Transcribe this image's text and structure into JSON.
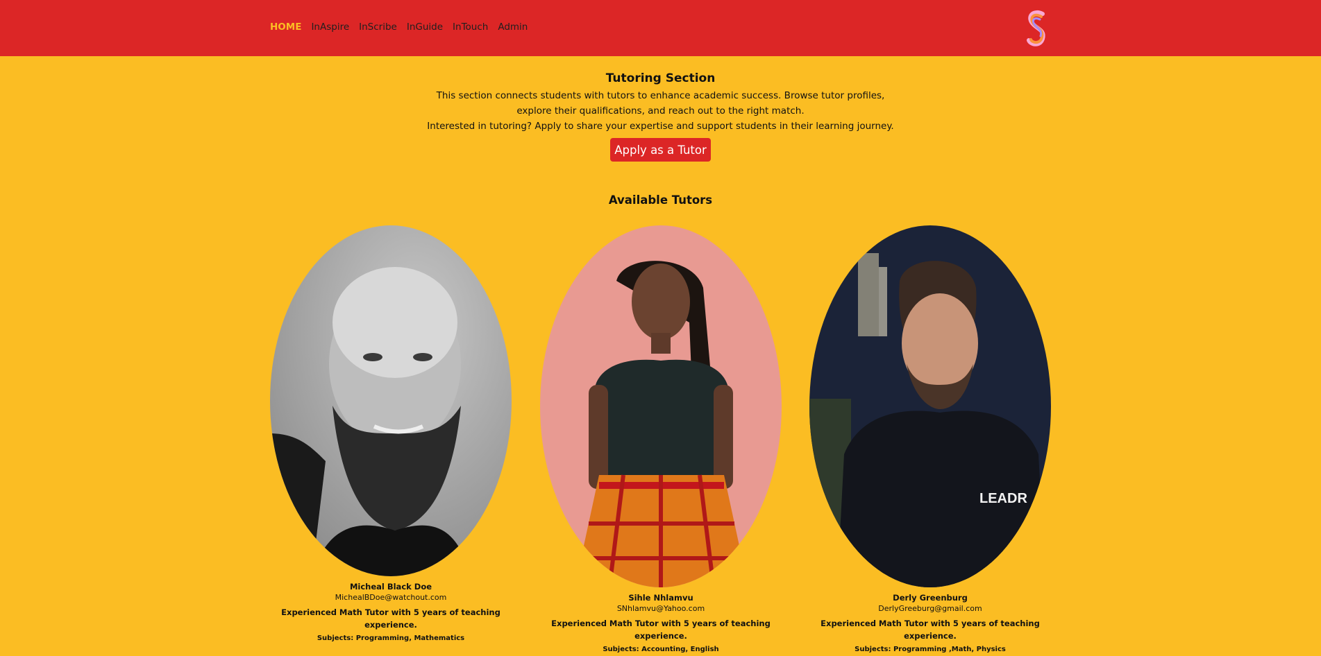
{
  "nav": {
    "items": [
      {
        "label": "HOME",
        "active": true
      },
      {
        "label": "InAspire",
        "active": false
      },
      {
        "label": "InScribe",
        "active": false
      },
      {
        "label": "InGuide",
        "active": false
      },
      {
        "label": "InTouch",
        "active": false
      },
      {
        "label": "Admin",
        "active": false
      }
    ],
    "logo_icon": "brand-s-logo-icon"
  },
  "intro": {
    "title": "Tutoring Section",
    "description": "This section connects students with tutors to enhance academic success. Browse tutor profiles, explore their qualifications, and reach out to the right match.",
    "cta_text": "Interested in tutoring? Apply to share your expertise and support students in their learning journey.",
    "apply_button": "Apply as a Tutor"
  },
  "tutors_heading": "Available Tutors",
  "tutors": [
    {
      "name": "Micheal Black Doe",
      "email": "MichealBDoe@watchout.com",
      "description": "Experienced Math Tutor with 5 years of teaching experience.",
      "subjects": "Subjects: Programming, Mathematics",
      "photo": "bearded-man-bw-portrait"
    },
    {
      "name": "Sihle Nhlamvu",
      "email": "SNhlamvu@Yahoo.com",
      "description": "Experienced Math Tutor with 5 years of teaching experience.",
      "subjects": "Subjects: Accounting, English",
      "photo": "woman-pink-background-portrait"
    },
    {
      "name": "Derly Greenburg",
      "email": "DerlyGreeburg@gmail.com",
      "description": "Experienced Math Tutor with 5 years of teaching experience.",
      "subjects": "Subjects: Programming ,Math, Physics",
      "photo": "man-black-hoodie-portrait",
      "photo_text": "LEADR"
    }
  ],
  "colors": {
    "header": "#dc2626",
    "background": "#fbbd23",
    "active_nav": "#fbbd23",
    "button": "#dc2626"
  }
}
